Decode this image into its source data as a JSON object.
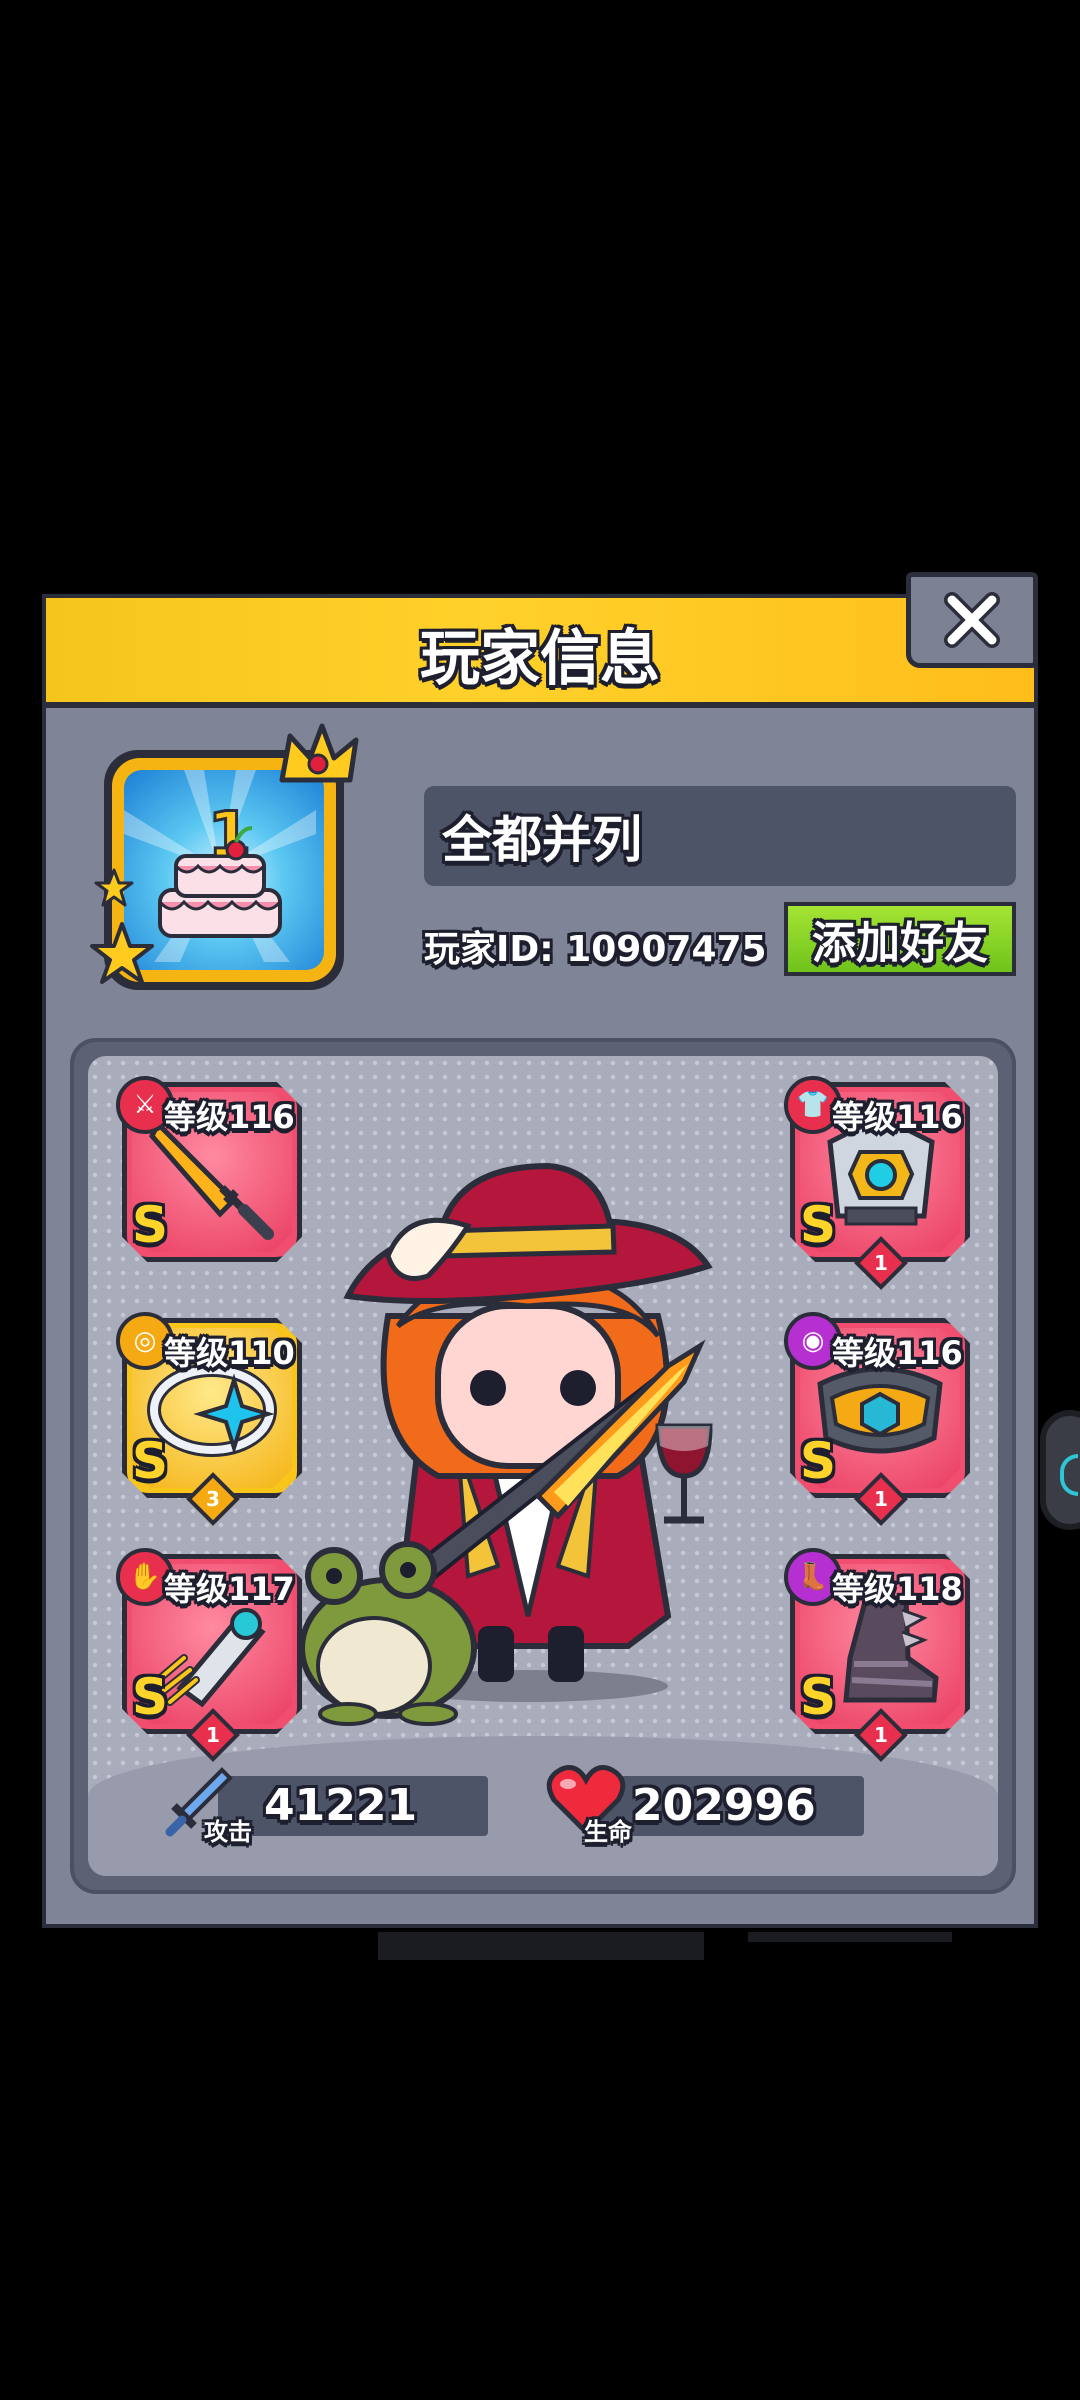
{
  "dialog": {
    "title": "玩家信息",
    "close_icon": "close-icon"
  },
  "player": {
    "name": "全都并列",
    "id_text": "玩家ID: 10907475",
    "avatar_icon": "birthday-cake-icon",
    "avatar_number": "1",
    "add_friend_label": "添加好友"
  },
  "equipment": {
    "left": [
      {
        "icon": "sword-icon",
        "badge_icon": "weapon-badge-icon",
        "level": "等级116",
        "grade": "S",
        "stars": ""
      },
      {
        "icon": "ring-icon",
        "badge_icon": "ring-badge-icon",
        "level": "等级110",
        "grade": "S",
        "stars": "3"
      },
      {
        "icon": "gauntlet-icon",
        "badge_icon": "glove-badge-icon",
        "level": "等级117",
        "grade": "S",
        "stars": "1"
      }
    ],
    "right": [
      {
        "icon": "armor-icon",
        "badge_icon": "shirt-badge-icon",
        "level": "等级116",
        "grade": "S",
        "stars": "1"
      },
      {
        "icon": "belt-icon",
        "badge_icon": "belt-badge-icon",
        "level": "等级116",
        "grade": "S",
        "stars": "1"
      },
      {
        "icon": "boots-icon",
        "badge_icon": "boot-badge-icon",
        "level": "等级118",
        "grade": "S",
        "stars": "1"
      }
    ]
  },
  "stats": {
    "attack_label": "攻击",
    "attack_value": "41221",
    "hp_label": "生命",
    "hp_value": "202996"
  },
  "colors": {
    "header_yellow": "#ffd12a",
    "dialog_gray": "#7f8597",
    "slot_red": "#f14d6f",
    "slot_gold": "#f9c51b",
    "friend_green": "#7ccc1f"
  }
}
